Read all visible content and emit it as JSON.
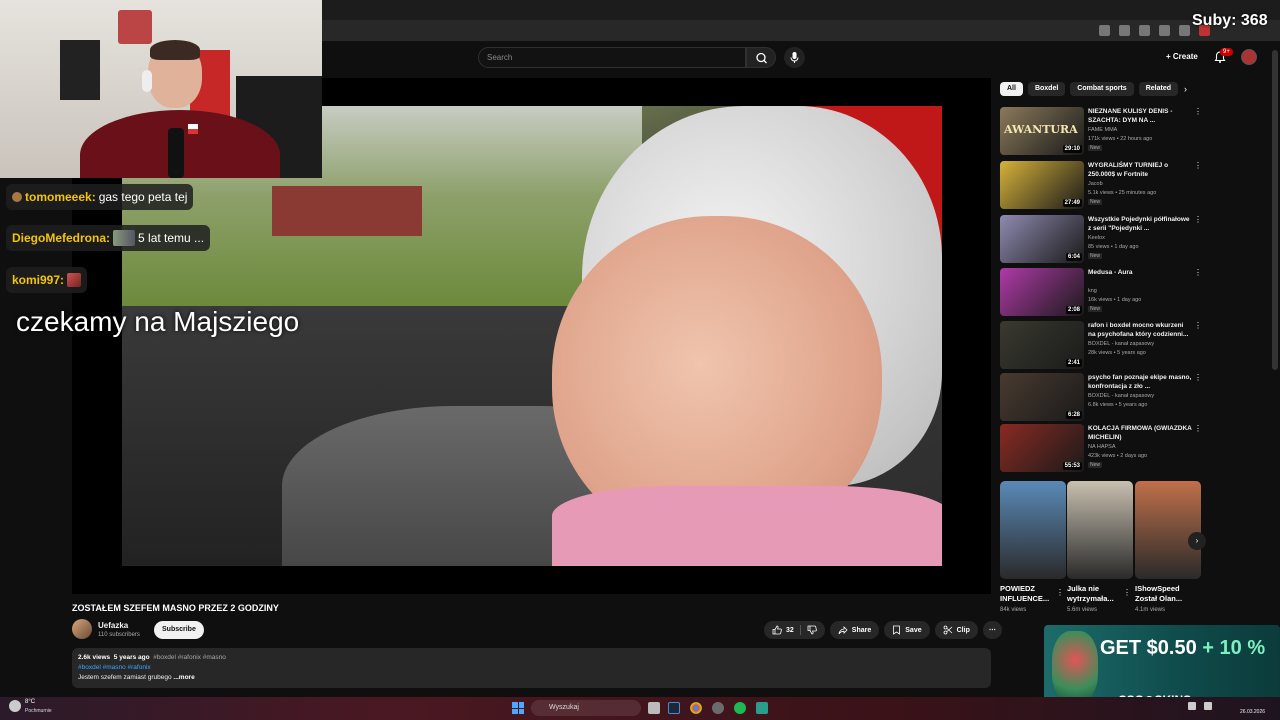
{
  "overlay": {
    "subs_label": "Suby: 368",
    "chat": [
      {
        "user": "tomomeeek:",
        "message": "gas tego peta tej"
      },
      {
        "user": "DiegoMefedrona:",
        "message": "5 lat temu ..."
      },
      {
        "user": "komi997:",
        "message": ""
      }
    ],
    "big_text": "czekamy na Majsziego",
    "ad": {
      "offer": "GET $0.50",
      "bonus": "+ 10 %",
      "brand": "CSG◎SKINS"
    }
  },
  "masthead": {
    "search_placeholder": "Search",
    "create_label": "Create",
    "notif_badge": "9+"
  },
  "video": {
    "title": "ZOSTAŁEM SZEFEM MASNO PRZEZ 2 GODZINY",
    "channel": "Uefazka",
    "subscribers": "110 subscribers",
    "subscribe_label": "Subscribe",
    "likes": "32",
    "share_label": "Share",
    "save_label": "Save",
    "clip_label": "Clip",
    "description": {
      "views": "2.6k views",
      "age": "5 years ago",
      "tags_inline": "#boxdel #rafonix #masno",
      "tags_line": "#boxdel #masno #rafonix",
      "text": "Jestem szefem zamiast grubego",
      "more": "...more"
    }
  },
  "chips": [
    "All",
    "Boxdel",
    "Combat sports",
    "Related"
  ],
  "recommendations": [
    {
      "title": "NIEZNANE KULISY DENIS - SZACHTA: DYM NA ...",
      "channel": "FAME MMA",
      "meta": "171k views • 22 hours ago",
      "badge": "New",
      "duration": "29:10",
      "color": "#8a7a5a",
      "thumb_text": "AWANTURA"
    },
    {
      "title": "WYGRALIŚMY TURNIEJ o 250.000$ w Fortnite",
      "channel": "Jacob",
      "meta": "5.1k views • 25 minutes ago",
      "badge": "New",
      "duration": "27:49",
      "color": "#d6b23a",
      "thumb_text": ""
    },
    {
      "title": "Wszystkie Pojedynki półfinałowe z serii \"Pojedynki ...",
      "channel": "Keelox",
      "meta": "85 views • 1 day ago",
      "badge": "New",
      "duration": "6:04",
      "color": "#8f8ab0",
      "thumb_text": ""
    },
    {
      "title": "Medusa - Aura",
      "channel": "kng",
      "meta": "16k views • 1 day ago",
      "badge": "New",
      "duration": "2:08",
      "color": "#b03aa8",
      "thumb_text": ""
    },
    {
      "title": "rafon i boxdel mocno wkurzeni na psychofana który codzienni...",
      "channel": "BOXDEL - kanał zapasowy",
      "meta": "28k views • 5 years ago",
      "badge": "",
      "duration": "2:41",
      "color": "#3a3a30",
      "thumb_text": ""
    },
    {
      "title": "psycho fan poznaje ekipe masno, konfrontacja z zło ...",
      "channel": "BOXDEL - kanał zapasowy",
      "meta": "6.8k views • 5 years ago",
      "badge": "",
      "duration": "6:28",
      "color": "#4a3a30",
      "thumb_text": ""
    },
    {
      "title": "KOLACJA FIRMOWA (GWIAZDKA MICHELIN)",
      "channel": "NA HAPSA",
      "meta": "423k views • 2 days ago",
      "badge": "New",
      "duration": "55:53",
      "color": "#8a2a22",
      "thumb_text": ""
    }
  ],
  "shorts": [
    {
      "title": "POWIEDZ INFLUENCE...",
      "views": "84k views",
      "color": "#5a8ab8"
    },
    {
      "title": "Julka nie wytrzymała...",
      "views": "5.6m views",
      "color": "#c8c0b0"
    },
    {
      "title": "IShowSpeed Został Olan...",
      "views": "4.1m views",
      "color": "#c0704a"
    }
  ],
  "taskbar": {
    "temp": "8°C",
    "weather": "Pochmurnie",
    "search": "Wyszukaj",
    "date": "26.03.2026"
  }
}
